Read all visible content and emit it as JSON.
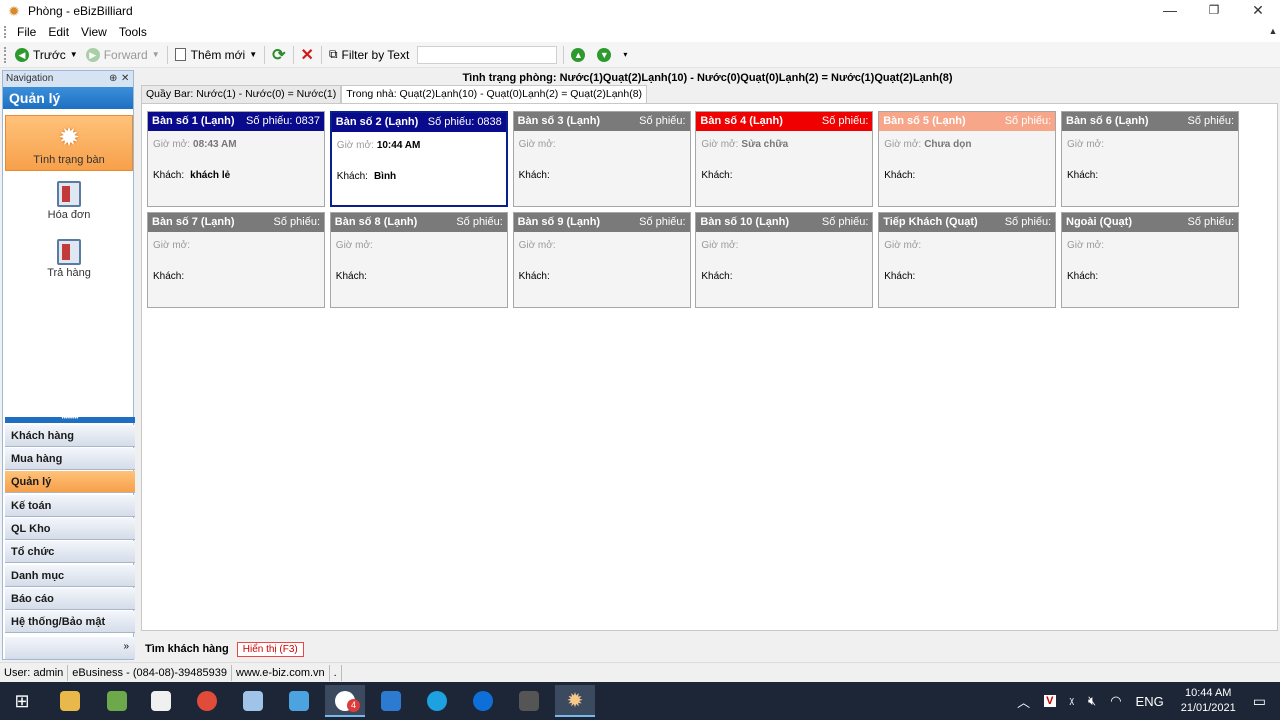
{
  "window": {
    "title": "Phòng - eBizBilliard",
    "controls": {
      "minimize": "—",
      "restore": "❐",
      "close": "✕"
    }
  },
  "menu": [
    "File",
    "Edit",
    "View",
    "Tools"
  ],
  "toolbar": {
    "back": "Trước",
    "forward": "Forward",
    "new": "Thêm mới",
    "filter": "Filter by Text",
    "filter_value": ""
  },
  "navigation": {
    "header": "Navigation",
    "title": "Quản lý",
    "items": [
      {
        "label": "Tình trạng bàn",
        "icon": "gear-icon",
        "active": true
      },
      {
        "label": "Hóa đơn",
        "icon": "invoice-icon",
        "active": false
      },
      {
        "label": "Trả hàng",
        "icon": "return-icon",
        "active": false
      }
    ],
    "categories": [
      {
        "label": "Khách hàng"
      },
      {
        "label": "Mua hàng"
      },
      {
        "label": "Quản lý",
        "active": true
      },
      {
        "label": "Kế toán"
      },
      {
        "label": "QL Kho"
      },
      {
        "label": "Tổ chức"
      },
      {
        "label": "Danh mục"
      },
      {
        "label": "Báo cáo"
      },
      {
        "label": "Hệ thống/Bảo mật"
      }
    ]
  },
  "main": {
    "room_status": "Tình trạng phòng: Nước(1)Quạt(2)Lạnh(10) - Nước(0)Quạt(0)Lạnh(2) = Nước(1)Quạt(2)Lạnh(8)",
    "tabs": [
      {
        "label": "Quầy Bar: Nước(1) - Nước(0) = Nước(1)",
        "active": false
      },
      {
        "label": "Trong nhà: Quạt(2)Lạnh(10) - Quạt(0)Lạnh(2) = Quạt(2)Lạnh(8)",
        "active": true
      }
    ],
    "labels": {
      "open_time": "Giờ mở:",
      "customer": "Khách:"
    },
    "tables": [
      {
        "name": "Bàn số 1 (Lạnh)",
        "ticket": "Số phiếu: 0837",
        "time": "08:43 AM",
        "customer": "khách lẻ",
        "color": "#0a0a8c",
        "selected": false
      },
      {
        "name": "Bàn số 2 (Lạnh)",
        "ticket": "Số phiếu: 0838",
        "time": "10:44 AM",
        "customer": "Bình",
        "color": "#0a0a8c",
        "selected": true
      },
      {
        "name": "Bàn số 3 (Lạnh)",
        "ticket": "Số phiếu:",
        "time": "",
        "customer": "",
        "color": "#7a7a7a"
      },
      {
        "name": "Bàn số 4 (Lạnh)",
        "ticket": "Số phiếu:",
        "time": "Sửa chữa",
        "customer": "",
        "color": "#f00000"
      },
      {
        "name": "Bàn số 5 (Lạnh)",
        "ticket": "Số phiếu:",
        "time": "Chưa dọn",
        "customer": "",
        "color": "#f7a68a"
      },
      {
        "name": "Bàn số 6 (Lạnh)",
        "ticket": "Số phiếu:",
        "time": "",
        "customer": "",
        "color": "#7a7a7a"
      },
      {
        "name": "Bàn số 7 (Lạnh)",
        "ticket": "Số phiếu:",
        "time": "",
        "customer": "",
        "color": "#7a7a7a"
      },
      {
        "name": "Bàn số 8 (Lạnh)",
        "ticket": "Số phiếu:",
        "time": "",
        "customer": "",
        "color": "#7a7a7a"
      },
      {
        "name": "Bàn số 9 (Lạnh)",
        "ticket": "Số phiếu:",
        "time": "",
        "customer": "",
        "color": "#7a7a7a"
      },
      {
        "name": "Bàn số 10 (Lạnh)",
        "ticket": "Số phiếu:",
        "time": "",
        "customer": "",
        "color": "#7a7a7a"
      },
      {
        "name": "Tiếp Khách (Quạt)",
        "ticket": "Số phiếu:",
        "time": "",
        "customer": "",
        "color": "#7a7a7a"
      },
      {
        "name": "Ngoài (Quạt)",
        "ticket": "Số phiếu:",
        "time": "",
        "customer": "",
        "color": "#7a7a7a"
      }
    ]
  },
  "bottom": {
    "find": "Tìm khách hàng",
    "show": "Hiển thị (F3)"
  },
  "status": {
    "user": "User: admin",
    "company": "eBusiness - (084-08)-39485939",
    "web": "www.e-biz.com.vn",
    "extra": "."
  },
  "tray": {
    "lang": "ENG",
    "time": "10:44 AM",
    "date": "21/01/2021",
    "badge": "4"
  }
}
